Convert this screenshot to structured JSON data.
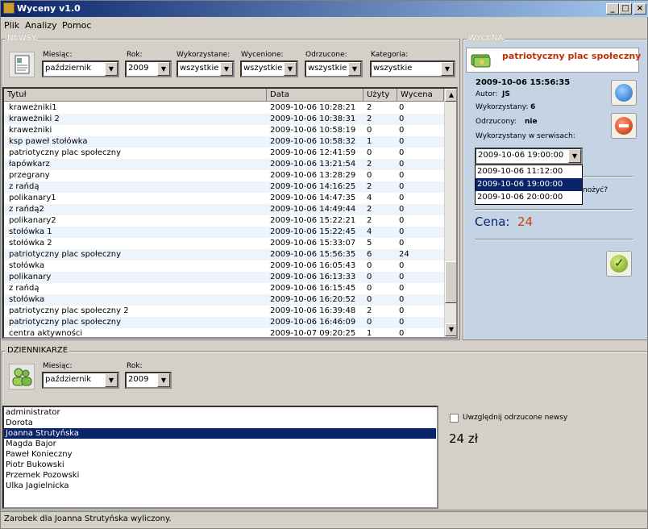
{
  "window": {
    "title": "Wyceny v1.0"
  },
  "menu": [
    "Plik",
    "Analizy",
    "Pomoc"
  ],
  "newsy": {
    "group_label": "NEWSY",
    "filters": {
      "miesiac": {
        "label": "Miesiąc:",
        "value": "październik"
      },
      "rok": {
        "label": "Rok:",
        "value": "2009"
      },
      "wykorzystane": {
        "label": "Wykorzystane:",
        "value": "wszystkie"
      },
      "wycenione": {
        "label": "Wycenione:",
        "value": "wszystkie"
      },
      "odrzucone": {
        "label": "Odrzucone:",
        "value": "wszystkie"
      },
      "kategoria": {
        "label": "Kategoria:",
        "value": "wszystkie"
      }
    },
    "columns": [
      "Tytuł",
      "Data",
      "Użyty",
      "Wycena"
    ],
    "rows": [
      [
        "kraweżniki1",
        "2009-10-06 10:28:21",
        "2",
        "0"
      ],
      [
        "kraweżniki 2",
        "2009-10-06 10:38:31",
        "2",
        "0"
      ],
      [
        "kraweżniki",
        "2009-10-06 10:58:19",
        "0",
        "0"
      ],
      [
        "ksp paweł stołówka",
        "2009-10-06 10:58:32",
        "1",
        "0"
      ],
      [
        "patriotyczny plac społeczny",
        "2009-10-06 12:41:59",
        "0",
        "0"
      ],
      [
        "łapówkarz",
        "2009-10-06 13:21:54",
        "2",
        "0"
      ],
      [
        "przegrany",
        "2009-10-06 13:28:29",
        "0",
        "0"
      ],
      [
        "z rańdą",
        "2009-10-06 14:16:25",
        "2",
        "0"
      ],
      [
        "polikanary1",
        "2009-10-06 14:47:35",
        "4",
        "0"
      ],
      [
        "z rańdą2",
        "2009-10-06 14:49:44",
        "2",
        "0"
      ],
      [
        "polikanary2",
        "2009-10-06 15:22:21",
        "2",
        "0"
      ],
      [
        "stołówka 1",
        "2009-10-06 15:22:45",
        "4",
        "0"
      ],
      [
        "stołówka 2",
        "2009-10-06 15:33:07",
        "5",
        "0"
      ],
      [
        "patriotyczny plac społeczny",
        "2009-10-06 15:56:35",
        "6",
        "24"
      ],
      [
        "stołówka",
        "2009-10-06 16:05:43",
        "0",
        "0"
      ],
      [
        "polikanary",
        "2009-10-06 16:13:33",
        "0",
        "0"
      ],
      [
        "z rańdą",
        "2009-10-06 16:15:45",
        "0",
        "0"
      ],
      [
        "stołówka",
        "2009-10-06 16:20:52",
        "0",
        "0"
      ],
      [
        "patriotyczny plac społeczny 2",
        "2009-10-06 16:39:48",
        "2",
        "0"
      ],
      [
        "patriotyczny plac społeczny",
        "2009-10-06 16:46:09",
        "0",
        "0"
      ],
      [
        "centra aktywności",
        "2009-10-07 09:20:25",
        "1",
        "0"
      ]
    ]
  },
  "wycena": {
    "group_label": "WYCENA",
    "title": "patriotyczny plac społeczny",
    "datetime": "2009-10-06 15:56:35",
    "autor_label": "Autor:",
    "autor": "JS",
    "wykorzystany_label": "Wykorzystany:",
    "wykorzystany": "6",
    "odrzucony_label": "Odrzucony:",
    "odrzucony": "nie",
    "serwisy_label": "Wykorzystany w serwisach:",
    "serwis_selected": "2009-10-06 19:00:00",
    "serwis_options": [
      "2009-10-06 11:12:00",
      "2009-10-06 19:00:00",
      "2009-10-06 20:00:00"
    ],
    "partial_text": "nożyć?",
    "cena_label": "Cena:",
    "cena": "24"
  },
  "dziennikarze": {
    "group_label": "DZIENNIKARZE",
    "miesiac": {
      "label": "Miesiąc:",
      "value": "październik"
    },
    "rok": {
      "label": "Rok:",
      "value": "2009"
    },
    "list": [
      "administrator",
      "Dorota",
      "Joanna Strutyńska",
      "Magda Bajor",
      "Paweł Konieczny",
      "Piotr Bukowski",
      "Przemek Pozowski",
      "Ulka Jagielnicka"
    ],
    "selected_index": 2,
    "checkbox_label": "Uwzględnij odrzucone newsy",
    "amount": "24 zł"
  },
  "status": "Zarobek dla Joanna Strutyńska wyliczony."
}
